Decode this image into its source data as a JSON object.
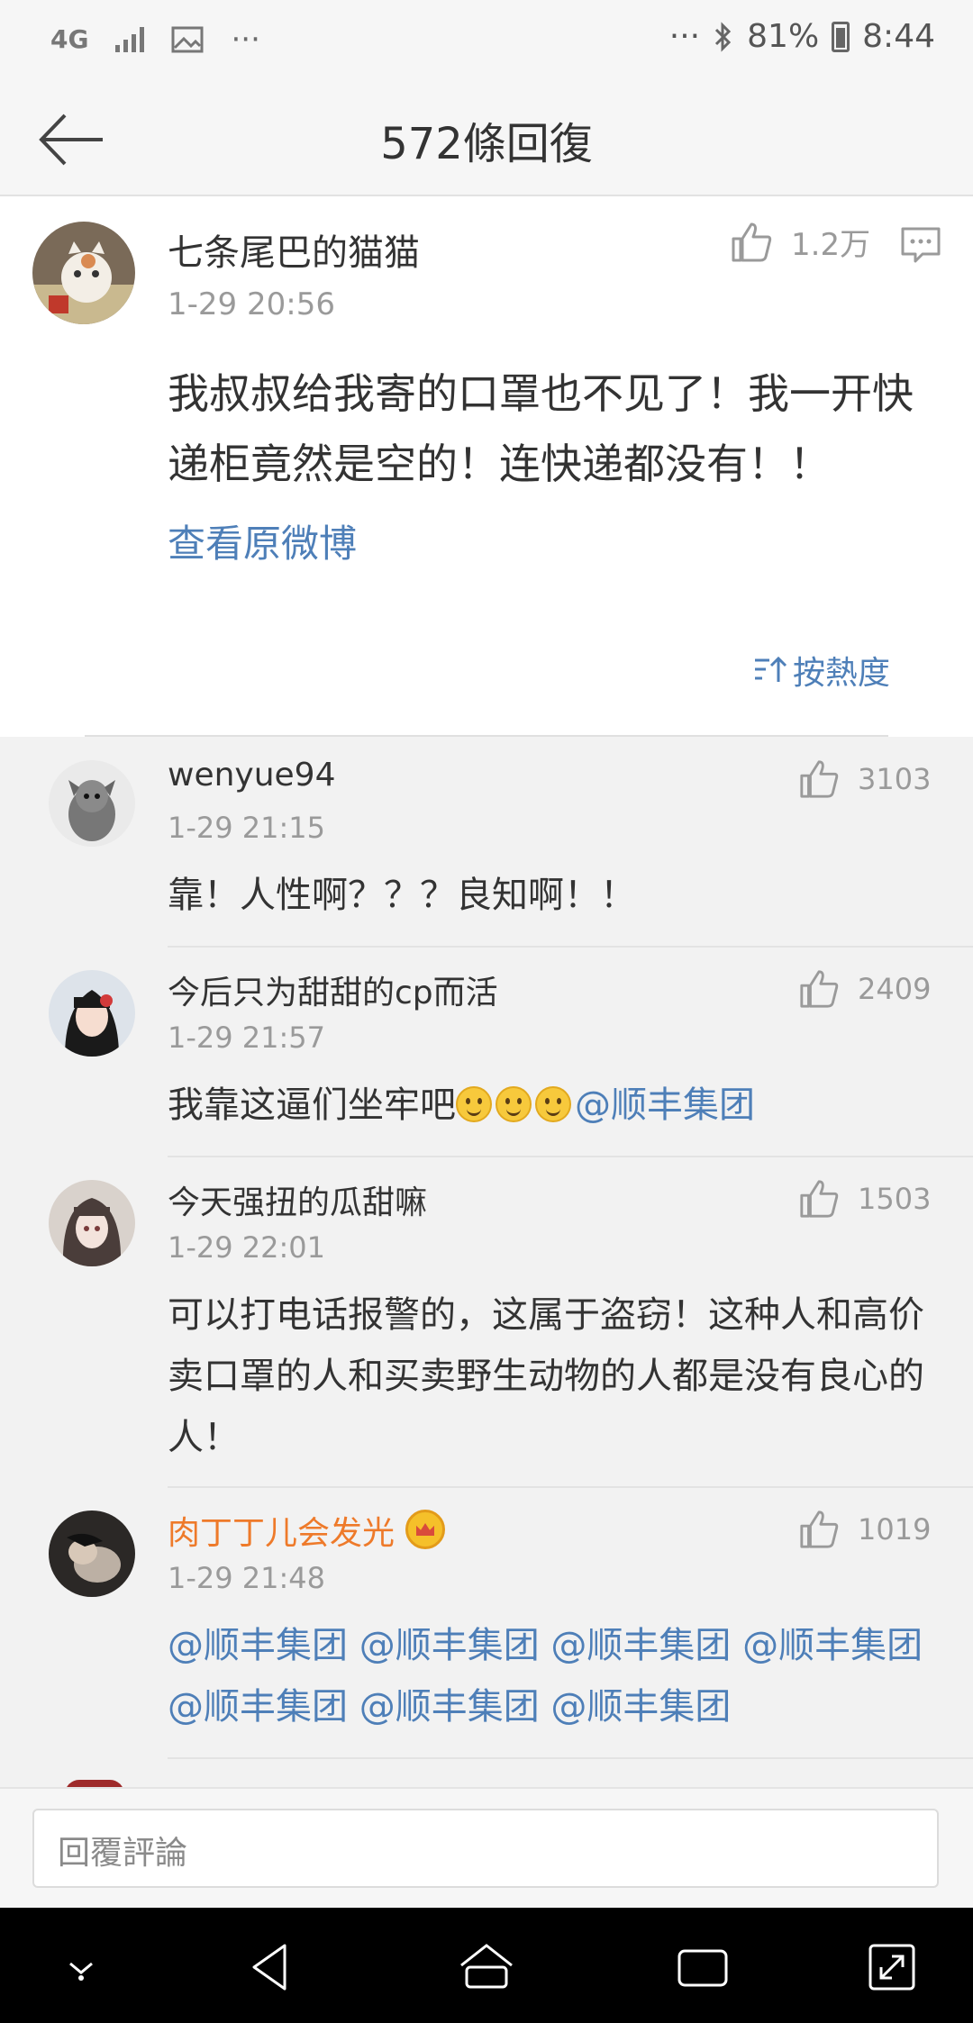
{
  "status_bar": {
    "network": "4G",
    "more_left": "···",
    "more_right": "···",
    "battery": "81%",
    "time": "8:44"
  },
  "header": {
    "title": "572條回復"
  },
  "post": {
    "username": "七条尾巴的猫猫",
    "time": "1-29 20:56",
    "likes": "1.2万",
    "body": "我叔叔给我寄的口罩也不见了！我一开快递柜竟然是空的！连快递都没有！！",
    "view_original": "查看原微博",
    "sort_label": "按熱度"
  },
  "replies": [
    {
      "username": "wenyue94",
      "time": "1-29 21:15",
      "likes": "3103",
      "body": "靠！人性啊？？？良知啊！！"
    },
    {
      "username": "今后只为甜甜的cp而活",
      "time": "1-29 21:57",
      "likes": "2409",
      "body": "我靠这逼们坐牢吧",
      "mention": "@顺丰集团"
    },
    {
      "username": "今天强扭的瓜甜嘛",
      "time": "1-29 22:01",
      "likes": "1503",
      "body": "可以打电话报警的，这属于盗窃！这种人和高价卖口罩的人和买卖野生动物的人都是没有良心的人！"
    },
    {
      "username": "肉丁丁儿会发光",
      "time": "1-29 21:48",
      "likes": "1019",
      "body": "@顺丰集团 @顺丰集团 @顺丰集团 @顺丰集团 @顺丰集团 @顺丰集团 @顺丰集团"
    }
  ],
  "input": {
    "placeholder": "回覆評論"
  },
  "colors": {
    "link": "#4e7fb8",
    "vip_name": "#ee7a2a",
    "meta_text": "#9a9a9a"
  }
}
